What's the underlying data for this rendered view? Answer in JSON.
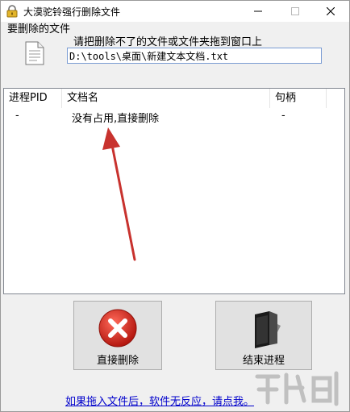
{
  "window": {
    "title": "大漠驼铃强行删除文件"
  },
  "file_section": {
    "label": "要删除的文件",
    "hint": "请把删除不了的文件或文件夹拖到窗口上",
    "path_value": "D:\\tools\\桌面\\新建文本文档.txt"
  },
  "process_list": {
    "columns": [
      "进程PID",
      "文档名",
      "句柄"
    ],
    "rows": [
      {
        "pid": "-",
        "name": "没有占用,直接删除",
        "handle": "-"
      }
    ]
  },
  "actions": {
    "delete_label": "直接删除",
    "kill_label": "结束进程"
  },
  "help_link": "如果拖入文件后，软件无反应，请点我。",
  "colors": {
    "delete_red": "#d8261c",
    "annotation_arrow": "#c8322e",
    "link_blue": "#0000cc"
  },
  "icons": {
    "app": "lock-icon",
    "file": "document-icon",
    "delete": "red-x-circle-icon",
    "kill": "black-folder-icon",
    "watermark": "download-site-logo"
  }
}
